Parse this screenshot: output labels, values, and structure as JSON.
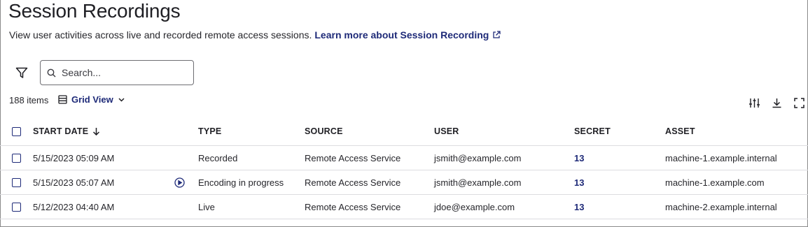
{
  "header": {
    "title": "Session Recordings",
    "description": "View user activities across live and recorded remote access sessions.",
    "learn_more": "Learn more about Session Recording"
  },
  "toolbar": {
    "search_placeholder": "Search...",
    "items_count": "188 items",
    "view_label": "Grid View",
    "icons": [
      "filter-icon",
      "search-icon",
      "grid-view-icon",
      "chevron-down-icon",
      "column-settings-icon",
      "download-icon",
      "fullscreen-icon"
    ]
  },
  "table": {
    "columns": [
      "START DATE",
      "TYPE",
      "SOURCE",
      "USER",
      "SECRET",
      "ASSET"
    ],
    "sort_column": "START DATE",
    "sort_direction": "descending",
    "rows": [
      {
        "start_date": "5/15/2023 05:09 AM",
        "type": "Recorded",
        "source": "Remote Access Service",
        "user": "jsmith@example.com",
        "secret": "13",
        "asset": "machine-1.example.internal",
        "playable": false
      },
      {
        "start_date": "5/15/2023 05:07 AM",
        "type": "Encoding in progress",
        "source": "Remote Access Service",
        "user": "jsmith@example.com",
        "secret": "13",
        "asset": "machine-1.example.com",
        "playable": true
      },
      {
        "start_date": "5/12/2023 04:40 AM",
        "type": "Live",
        "source": "Remote Access Service",
        "user": "jdoe@example.com",
        "secret": "13",
        "asset": "machine-2.example.internal",
        "playable": false
      }
    ]
  },
  "colors": {
    "link": "#1e2a78",
    "border": "#dcdce0",
    "text": "#26262b"
  }
}
